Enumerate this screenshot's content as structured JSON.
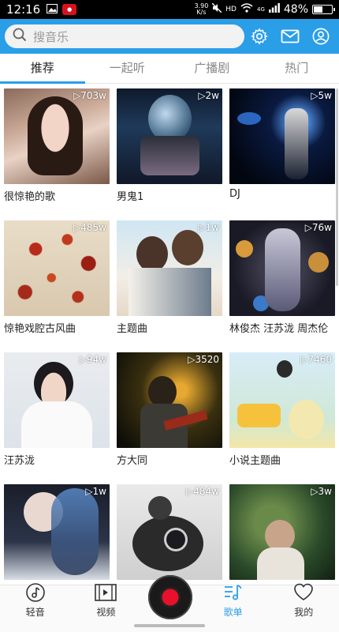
{
  "status_bar": {
    "time": "12:16",
    "speed_value": "3.90",
    "speed_unit": "K/s",
    "hd": "HD",
    "net": "4G",
    "battery": "48%",
    "battery_level": 0.48
  },
  "header": {
    "search_placeholder": "搜音乐"
  },
  "tabs": [
    {
      "label": "推荐",
      "active": true
    },
    {
      "label": "一起听",
      "active": false
    },
    {
      "label": "广播剧",
      "active": false
    },
    {
      "label": "热门",
      "active": false
    }
  ],
  "playlists": [
    {
      "title": "很惊艳的歌",
      "count": "703w"
    },
    {
      "title": "男鬼1",
      "count": "2w"
    },
    {
      "title": "DJ",
      "count": "5w"
    },
    {
      "title": "惊艳戏腔古风曲",
      "count": "485w"
    },
    {
      "title": "主题曲",
      "count": "1w"
    },
    {
      "title": "林俊杰 汪苏泷 周杰伦",
      "count": "76w"
    },
    {
      "title": "汪苏泷",
      "count": "94w"
    },
    {
      "title": "方大同",
      "count": "3520"
    },
    {
      "title": "小说主题曲",
      "count": "7460"
    },
    {
      "title": "",
      "count": "1w"
    },
    {
      "title": "",
      "count": "484w"
    },
    {
      "title": "",
      "count": "3w"
    }
  ],
  "bottom_nav": [
    {
      "label": "轻音",
      "icon": "note-icon",
      "active": false
    },
    {
      "label": "视频",
      "icon": "film-icon",
      "active": false
    },
    {
      "label": "歌单",
      "icon": "playlist-icon",
      "active": true
    },
    {
      "label": "我的",
      "icon": "heart-icon",
      "active": false
    }
  ],
  "colors": {
    "accent": "#2b9ee8",
    "disc_red": "#e8102a"
  }
}
